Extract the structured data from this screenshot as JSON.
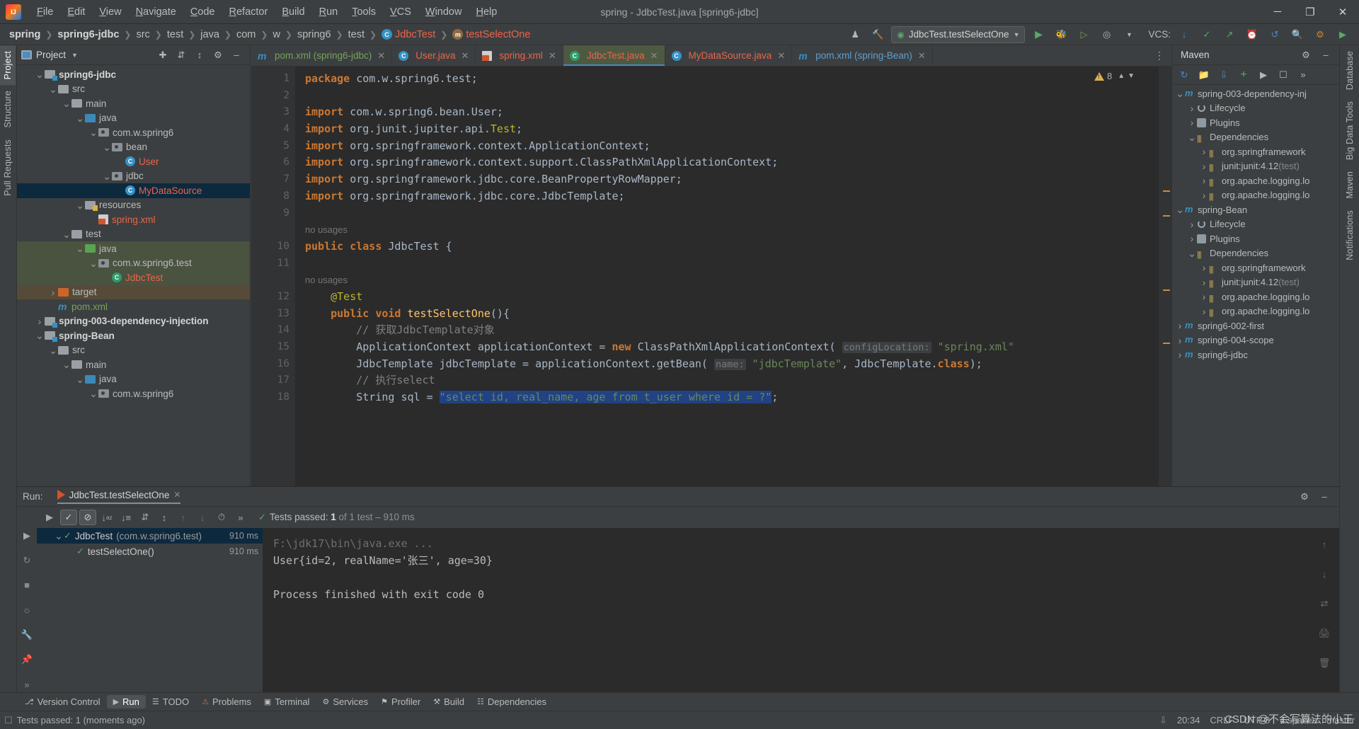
{
  "window": {
    "title": "spring - JdbcTest.java [spring6-jdbc]",
    "logo": "intellij-idea-logo",
    "minimize": "─",
    "maximize": "❐",
    "close": "✕"
  },
  "menubar": [
    {
      "label": "File"
    },
    {
      "label": "Edit"
    },
    {
      "label": "View"
    },
    {
      "label": "Navigate"
    },
    {
      "label": "Code"
    },
    {
      "label": "Refactor"
    },
    {
      "label": "Build"
    },
    {
      "label": "Run"
    },
    {
      "label": "Tools"
    },
    {
      "label": "VCS"
    },
    {
      "label": "Window"
    },
    {
      "label": "Help"
    }
  ],
  "breadcrumb": [
    {
      "label": "spring",
      "style": "bold"
    },
    {
      "label": "spring6-jdbc",
      "style": "bold"
    },
    {
      "label": "src",
      "style": "plain"
    },
    {
      "label": "test",
      "style": "plain"
    },
    {
      "label": "java",
      "style": "plain"
    },
    {
      "label": "com",
      "style": "plain"
    },
    {
      "label": "w",
      "style": "plain"
    },
    {
      "label": "spring6",
      "style": "plain"
    },
    {
      "label": "test",
      "style": "plain"
    },
    {
      "label": "JdbcTest",
      "style": "file",
      "icon": "class-icon"
    },
    {
      "label": "testSelectOne",
      "style": "file",
      "icon": "method-icon"
    }
  ],
  "navbar_right": {
    "run_config": "JdbcTest.testSelectOne",
    "vcs_label": "VCS:",
    "icons": [
      "user-settings-icon",
      "build-hammer-icon",
      "run-icon",
      "debug-icon",
      "run-coverage-icon",
      "profiler-icon",
      "vcs-update-icon",
      "vcs-commit-icon",
      "vcs-push-icon",
      "vcs-history-icon",
      "undo-icon",
      "search-icon",
      "plugin-icon",
      "more-icon"
    ]
  },
  "left_strip": [
    {
      "label": "Project",
      "selected": true
    },
    {
      "label": "Structure",
      "selected": false
    },
    {
      "label": "Pull Requests",
      "selected": false
    }
  ],
  "right_strip": [
    {
      "label": "Database"
    },
    {
      "label": "Big Data Tools"
    },
    {
      "label": "Maven"
    },
    {
      "label": "Notifications"
    }
  ],
  "project_panel": {
    "title": "Project",
    "toolbar_icons": [
      "locate-icon",
      "expand-all-icon",
      "collapse-all-icon",
      "settings-gear-icon",
      "hide-icon"
    ],
    "tree": [
      {
        "label": "spring6-jdbc",
        "indent": 1,
        "arrow": "v",
        "icon": "module-folder",
        "style": "bold"
      },
      {
        "label": "src",
        "indent": 2,
        "arrow": "v",
        "icon": "folder",
        "style": "plain"
      },
      {
        "label": "main",
        "indent": 3,
        "arrow": "v",
        "icon": "folder",
        "style": "plain"
      },
      {
        "label": "java",
        "indent": 4,
        "arrow": "v",
        "icon": "folder-blue",
        "style": "plain"
      },
      {
        "label": "com.w.spring6",
        "indent": 5,
        "arrow": "v",
        "icon": "package",
        "style": "plain"
      },
      {
        "label": "bean",
        "indent": 6,
        "arrow": "v",
        "icon": "package",
        "style": "plain"
      },
      {
        "label": "User",
        "indent": 7,
        "arrow": "",
        "icon": "class",
        "style": "red"
      },
      {
        "label": "jdbc",
        "indent": 6,
        "arrow": "v",
        "icon": "package",
        "style": "plain"
      },
      {
        "label": "MyDataSource",
        "indent": 7,
        "arrow": "",
        "icon": "class",
        "style": "red",
        "row": "sel-blue"
      },
      {
        "label": "resources",
        "indent": 4,
        "arrow": "v",
        "icon": "folder-res",
        "style": "plain"
      },
      {
        "label": "spring.xml",
        "indent": 5,
        "arrow": "",
        "icon": "xml",
        "style": "red"
      },
      {
        "label": "test",
        "indent": 3,
        "arrow": "v",
        "icon": "folder",
        "style": "plain"
      },
      {
        "label": "java",
        "indent": 4,
        "arrow": "v",
        "icon": "folder-green",
        "style": "plain",
        "row": "sel-green"
      },
      {
        "label": "com.w.spring6.test",
        "indent": 5,
        "arrow": "v",
        "icon": "package",
        "style": "plain",
        "row": "sel-green"
      },
      {
        "label": "JdbcTest",
        "indent": 6,
        "arrow": "",
        "icon": "class-test",
        "style": "red",
        "row": "sel-green"
      },
      {
        "label": "target",
        "indent": 2,
        "arrow": ">",
        "icon": "folder-orange",
        "style": "plain",
        "row": "sel-brown"
      },
      {
        "label": "pom.xml",
        "indent": 2,
        "arrow": "",
        "icon": "maven",
        "style": "green"
      },
      {
        "label": "spring-003-dependency-injection",
        "indent": 1,
        "arrow": ">",
        "icon": "module-folder",
        "style": "bold"
      },
      {
        "label": "spring-Bean",
        "indent": 1,
        "arrow": "v",
        "icon": "module-folder",
        "style": "bold"
      },
      {
        "label": "src",
        "indent": 2,
        "arrow": "v",
        "icon": "folder",
        "style": "plain"
      },
      {
        "label": "main",
        "indent": 3,
        "arrow": "v",
        "icon": "folder",
        "style": "plain"
      },
      {
        "label": "java",
        "indent": 4,
        "arrow": "v",
        "icon": "folder-blue",
        "style": "plain"
      },
      {
        "label": "com.w.spring6",
        "indent": 5,
        "arrow": "v",
        "icon": "package",
        "style": "plain"
      }
    ]
  },
  "editor": {
    "tabs": [
      {
        "label": "pom.xml (spring6-jdbc)",
        "icon": "maven-icon",
        "color": "green",
        "active": false
      },
      {
        "label": "User.java",
        "icon": "class-icon",
        "color": "red",
        "active": false
      },
      {
        "label": "spring.xml",
        "icon": "spring-xml-icon",
        "color": "red",
        "active": false
      },
      {
        "label": "JdbcTest.java",
        "icon": "test-class-icon",
        "color": "red",
        "active": true
      },
      {
        "label": "MyDataSource.java",
        "icon": "class-icon",
        "color": "red",
        "active": false
      },
      {
        "label": "pom.xml (spring-Bean)",
        "icon": "maven-icon",
        "color": "blue",
        "active": false
      }
    ],
    "warning_count": "8",
    "lines": [
      {
        "num": "1",
        "type": "code",
        "html": "<span class=\"kw\">package</span> com.w.spring6.test;"
      },
      {
        "num": "2",
        "type": "code",
        "html": ""
      },
      {
        "num": "3",
        "type": "code",
        "fold": "top",
        "html": "<span class=\"kw\">import</span> com.w.spring6.bean.User;"
      },
      {
        "num": "4",
        "type": "code",
        "html": "<span class=\"kw\">import</span> org.junit.jupiter.api.<span class=\"ann\">Test</span>;"
      },
      {
        "num": "5",
        "type": "code",
        "html": "<span class=\"kw\">import</span> org.springframework.context.ApplicationContext;"
      },
      {
        "num": "6",
        "type": "code",
        "html": "<span class=\"kw\">import</span> org.springframework.context.support.ClassPathXmlApplicationContext;"
      },
      {
        "num": "7",
        "type": "code",
        "html": "<span class=\"kw\">import</span> org.springframework.jdbc.core.BeanPropertyRowMapper;"
      },
      {
        "num": "8",
        "type": "code",
        "fold": "bot",
        "html": "<span class=\"kw\">import</span> org.springframework.jdbc.core.JdbcTemplate;"
      },
      {
        "num": "9",
        "type": "code",
        "html": ""
      },
      {
        "num": "",
        "type": "usage",
        "html": "no usages"
      },
      {
        "num": "10",
        "type": "code",
        "gmark": "run",
        "html": "<span class=\"kw\">public class</span> <span class=\"cn\">JdbcTest</span> {"
      },
      {
        "num": "11",
        "type": "code",
        "html": ""
      },
      {
        "num": "",
        "type": "usage",
        "html": "    no usages"
      },
      {
        "num": "12",
        "type": "code",
        "html": "    <span class=\"ann\">@Test</span>"
      },
      {
        "num": "13",
        "type": "code",
        "gmark": "run",
        "fold": "top",
        "html": "    <span class=\"kw\">public void</span> <span class=\"mthname\">testSelectOne</span>(){"
      },
      {
        "num": "14",
        "type": "code",
        "html": "        <span class=\"cmt\">// 获取JdbcTemplate对象</span>"
      },
      {
        "num": "15",
        "type": "code",
        "html": "        ApplicationContext applicationContext = <span class=\"kw\">new</span> ClassPathXmlApplicationContext( <span class=\"hint\">configLocation:</span> <span class=\"str\">\"spring.xml\"</span>"
      },
      {
        "num": "16",
        "type": "code",
        "html": "        JdbcTemplate jdbcTemplate = applicationContext.getBean( <span class=\"hint\">name:</span> <span class=\"str\">\"jdbcTemplate\"</span>, JdbcTemplate.<span class=\"kw\">class</span>);"
      },
      {
        "num": "17",
        "type": "code",
        "html": "        <span class=\"cmt\">// 执行select</span>"
      },
      {
        "num": "18",
        "type": "code",
        "html": "        String sql = <span class=\"str selblock\">\"select id, real_name, age from t_user where id = ?\"</span>;"
      }
    ]
  },
  "maven_panel": {
    "title": "Maven",
    "toolbar_icons": [
      "reload-icon",
      "add-module-icon",
      "download-sources-icon",
      "add-icon",
      "run-icon",
      "toggle-offline-icon",
      "more-icon"
    ],
    "tree": [
      {
        "label": "spring-003-dependency-inj",
        "indent": 0,
        "arrow": "v",
        "icon": "maven",
        "style": "plain"
      },
      {
        "label": "Lifecycle",
        "indent": 1,
        "arrow": ">",
        "icon": "lifecycle",
        "style": "plain"
      },
      {
        "label": "Plugins",
        "indent": 1,
        "arrow": ">",
        "icon": "plugins",
        "style": "plain"
      },
      {
        "label": "Dependencies",
        "indent": 1,
        "arrow": "v",
        "icon": "deps",
        "style": "plain"
      },
      {
        "label": "org.springframework",
        "indent": 2,
        "arrow": ">",
        "icon": "bars",
        "style": "plain"
      },
      {
        "label": "junit:junit:4.12",
        "indent": 2,
        "arrow": ">",
        "icon": "bars",
        "style": "plain",
        "suffix": "(test)"
      },
      {
        "label": "org.apache.logging.lo",
        "indent": 2,
        "arrow": ">",
        "icon": "bars",
        "style": "plain"
      },
      {
        "label": "org.apache.logging.lo",
        "indent": 2,
        "arrow": ">",
        "icon": "bars",
        "style": "plain"
      },
      {
        "label": "spring-Bean",
        "indent": 0,
        "arrow": "v",
        "icon": "maven",
        "style": "plain"
      },
      {
        "label": "Lifecycle",
        "indent": 1,
        "arrow": ">",
        "icon": "lifecycle",
        "style": "plain"
      },
      {
        "label": "Plugins",
        "indent": 1,
        "arrow": ">",
        "icon": "plugins",
        "style": "plain"
      },
      {
        "label": "Dependencies",
        "indent": 1,
        "arrow": "v",
        "icon": "deps",
        "style": "plain"
      },
      {
        "label": "org.springframework",
        "indent": 2,
        "arrow": ">",
        "icon": "bars",
        "style": "plain"
      },
      {
        "label": "junit:junit:4.12",
        "indent": 2,
        "arrow": ">",
        "icon": "bars",
        "style": "plain",
        "suffix": "(test)"
      },
      {
        "label": "org.apache.logging.lo",
        "indent": 2,
        "arrow": ">",
        "icon": "bars",
        "style": "plain"
      },
      {
        "label": "org.apache.logging.lo",
        "indent": 2,
        "arrow": ">",
        "icon": "bars",
        "style": "plain"
      },
      {
        "label": "spring6-002-first",
        "indent": 0,
        "arrow": ">",
        "icon": "maven",
        "style": "plain"
      },
      {
        "label": "spring6-004-scope",
        "indent": 0,
        "arrow": ">",
        "icon": "maven",
        "style": "plain"
      },
      {
        "label": "spring6-jdbc",
        "indent": 0,
        "arrow": ">",
        "icon": "maven",
        "style": "plain"
      }
    ]
  },
  "run_panel": {
    "label": "Run:",
    "tab_title": "JdbcTest.testSelectOne",
    "toolbar_icons": [
      "rerun-icon",
      "show-passed-icon",
      "hide-ignored-icon",
      "sort-alpha-icon",
      "sort-duration-icon",
      "expand-all-icon",
      "collapse-all-icon",
      "prev-failed-icon",
      "next-failed-icon",
      "history-icon",
      "more-icon"
    ],
    "status_prefix": "Tests passed: ",
    "status_count": "1",
    "status_suffix": " of 1 test – 910 ms",
    "tests": [
      {
        "label": "JdbcTest",
        "package": "(com.w.spring6.test)",
        "time": "910 ms",
        "indent": 1,
        "arrow": "v",
        "selected": true
      },
      {
        "label": "testSelectOne()",
        "package": "",
        "time": "910 ms",
        "indent": 2,
        "arrow": "",
        "selected": false
      }
    ],
    "console": [
      {
        "text": "F:\\jdk17\\bin\\java.exe ...",
        "style": "cmd"
      },
      {
        "text": "User{id=2, realName='张三', age=30}",
        "style": "normal"
      },
      {
        "text": "",
        "style": "normal"
      },
      {
        "text": "Process finished with exit code 0",
        "style": "normal"
      }
    ],
    "left_icons": [
      "filter-icon",
      "rerun-failed-icon",
      "settings-icon",
      "pin-icon",
      "camera-icon",
      "export-icon",
      "more-icon"
    ],
    "right_icons": [
      "scroll-up-icon",
      "scroll-down-icon",
      "soft-wrap-icon",
      "print-icon",
      "clear-all-icon"
    ]
  },
  "bottom_bar": [
    {
      "label": "Version Control",
      "icon": "vcs-icon",
      "selected": false
    },
    {
      "label": "Run",
      "icon": "run-icon",
      "selected": true
    },
    {
      "label": "TODO",
      "icon": "todo-icon",
      "selected": false
    },
    {
      "label": "Problems",
      "icon": "problems-icon",
      "selected": false
    },
    {
      "label": "Terminal",
      "icon": "terminal-icon",
      "selected": false
    },
    {
      "label": "Services",
      "icon": "services-icon",
      "selected": false
    },
    {
      "label": "Profiler",
      "icon": "profiler-icon",
      "selected": false
    },
    {
      "label": "Build",
      "icon": "build-icon",
      "selected": false
    },
    {
      "label": "Dependencies",
      "icon": "dependencies-icon",
      "selected": false
    }
  ],
  "status_bar": {
    "message": "Tests passed: 1 (moments ago)",
    "time": "20:34",
    "line_sep": "CRLF",
    "encoding": "UTF-8",
    "indent": "4 spaces",
    "branch": "master",
    "watermark": "CSDN @不会写算法的小王"
  }
}
